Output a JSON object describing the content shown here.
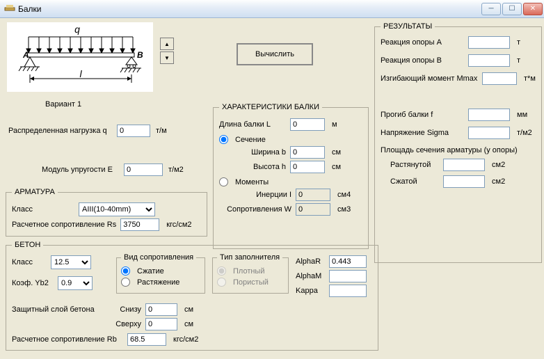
{
  "window": {
    "title": "Балки"
  },
  "diagram": {
    "q": "q",
    "A": "A",
    "B": "B",
    "l": "l"
  },
  "variant_label": "Вариант 1",
  "calc_button": "Вычислить",
  "inputs_left": {
    "distributed_load_label": "Распределенная нагрузка  q",
    "distributed_load_value": "0",
    "distributed_load_unit": "т/м",
    "elastic_modulus_label": "Модуль упругости  E",
    "elastic_modulus_value": "0",
    "elastic_modulus_unit": "т/м2"
  },
  "rebar": {
    "legend": "АРМАТУРА",
    "class_label": "Класс",
    "class_value": "AIII(10-40mm)",
    "rs_label": "Расчетное сопротивление Rs",
    "rs_value": "3750",
    "rs_unit": "кгс/см2"
  },
  "concrete": {
    "legend": "БЕТОН",
    "class_label": "Класс",
    "class_value": "12.5",
    "yb2_label": "Коэф. Yb2",
    "yb2_value": "0.9",
    "resist_label": "Вид сопротивления",
    "resist_compress": "Сжатие",
    "resist_tension": "Растяжение",
    "filler_label": "Тип заполнителя",
    "filler_dense": "Плотный",
    "filler_porous": "Пористый",
    "cover_label": "Защитный слой бетона",
    "cover_bottom_label": "Снизу",
    "cover_bottom_value": "0",
    "cover_top_label": "Сверху",
    "cover_top_value": "0",
    "cover_unit": "см",
    "rb_label": "Расчетное сопротивление Rb",
    "rb_value": "68.5",
    "rb_unit": "кгс/см2",
    "alphaR_label": "AlphaR",
    "alphaR_value": "0.443",
    "alphaM_label": "AlphaM",
    "alphaM_value": "",
    "kappa_label": "Kappa",
    "kappa_value": ""
  },
  "beam_props": {
    "legend": "ХАРАКТЕРИСТИКИ БАЛКИ",
    "length_label": "Длина балки L",
    "length_value": "0",
    "length_unit": "м",
    "section_label": "Сечение",
    "width_label": "Ширина  b",
    "width_value": "0",
    "height_label": "Высота  h",
    "height_value": "0",
    "section_unit": "см",
    "moments_label": "Моменты",
    "inertia_label": "Инерции   I",
    "inertia_value": "0",
    "inertia_unit": "см4",
    "resist_label": "Сопротивления  W",
    "resist_value": "0",
    "resist_unit": "см3"
  },
  "results": {
    "legend": "РЕЗУЛЬТАТЫ",
    "ra_label": "Реакция опоры A",
    "ra_unit": "т",
    "rb_label": "Реакция опоры B",
    "rb_unit": "т",
    "mmax_label": "Изгибающий момент Mmax",
    "mmax_unit": "т*м",
    "defl_label": "Прогиб балки  f",
    "defl_unit": "мм",
    "sigma_label": "Напряжение Sigma",
    "sigma_unit": "т/м2",
    "rebar_area_label": "Площадь сечения арматуры (у опоры)",
    "tension_label": "Растянутой",
    "compress_label": "Сжатой",
    "area_unit": "см2"
  }
}
